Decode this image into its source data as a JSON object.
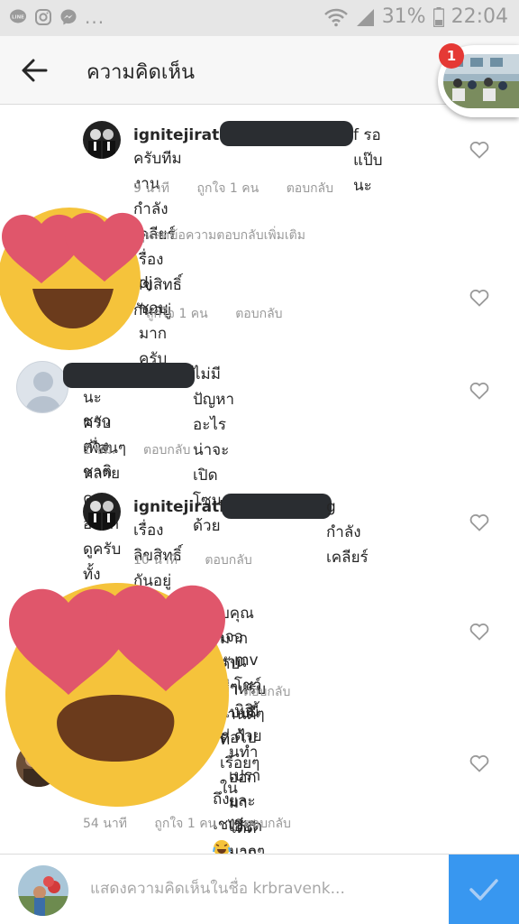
{
  "status_bar": {
    "more": "...",
    "battery": "31%",
    "time": "22:04",
    "icons": [
      "line-icon",
      "instagram-icon",
      "messenger-icon",
      "wifi-icon",
      "signal-icon",
      "battery-icon"
    ]
  },
  "header": {
    "title": "ความคิดเห็น",
    "notification_count": "1"
  },
  "view_more_replies": "ดูหลดข้อความตอบกลับเพิ่มเติม",
  "comments": [
    {
      "username": "ignitejirath",
      "text_tail": "f รอแป๊บนะ",
      "text_line2": "ครับทีมงานกำลังเคลียร์เรื่องลิขสิทธิ์กันอยู่",
      "time": "9 นาที",
      "likes": "ถูกใจ 1 คน",
      "reply": "ตอบกลับ"
    },
    {
      "text": "dj ชอบมากครับ",
      "likes": "ถูกใจ 1 คน",
      "reply": "ตอบกลับ"
    },
    {
      "text_tail": "ไม่มีปัญหาอะไร น่าจะเปิดโซนด้วย",
      "text_line2": "นะครับ เพื่อนๆหลายคนอยากดูครับทั้งชาวไทยและ",
      "text_line3": "ชาวต่างชาติ",
      "time": "1 ชม.",
      "reply": "ตอบกลับ"
    },
    {
      "username": "ignitejirath",
      "text_tail": "g กำลังเคลียร์",
      "text_line2": "เรื่องลิขสิทธิ์กันอยู่ครับ",
      "time": "10 นาที",
      "reply": "ตอบกลับ"
    },
    {
      "text_line1": "บคุณมากคับ สำหรับงานดีๆที่",
      "text_line2": "เจองานดีๆแบบนี้ต่อไปเรื่อยๆใน",
      "text_line3": "mv โชว์นิจิด้วย",
      "reply": "ตอบกลับ"
    },
    {
      "text_line1": "นทำออกมาได้ดีมากครับ ผลงาน",
      "text_line2": "เปรายละเอียดมากๆ ดูจบน้ำตาไหล",
      "text_line3": "ถึงเชเช่",
      "time": "54 นาที",
      "likes": "ถูกใจ 1 คน",
      "reply": "ตอบกลับ"
    }
  ],
  "input": {
    "placeholder": "แสดงความคิดเห็นในชื่อ krbravenk..."
  },
  "colors": {
    "accent": "#3897f0",
    "badge": "#e53935",
    "emoji_face": "#f5c33b",
    "emoji_heart": "#e0566b"
  }
}
